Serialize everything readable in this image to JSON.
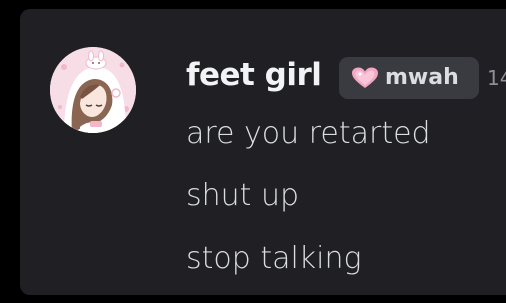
{
  "message_group": {
    "author": {
      "username": "feet girl",
      "avatar_icon": "anime-avatar-icon",
      "tag": {
        "icon": "pink-heart-icon",
        "label": "mwah",
        "color": "#f4a7c3"
      },
      "timestamp_partial": "14"
    },
    "messages": [
      "are you retarted",
      "shut up",
      "stop talking"
    ]
  },
  "colors": {
    "background": "#1f1f24",
    "username": "#f2f3f5",
    "message_text": "#dbdee1",
    "tag_background": "#3a3a41",
    "timestamp": "#8e9096"
  }
}
